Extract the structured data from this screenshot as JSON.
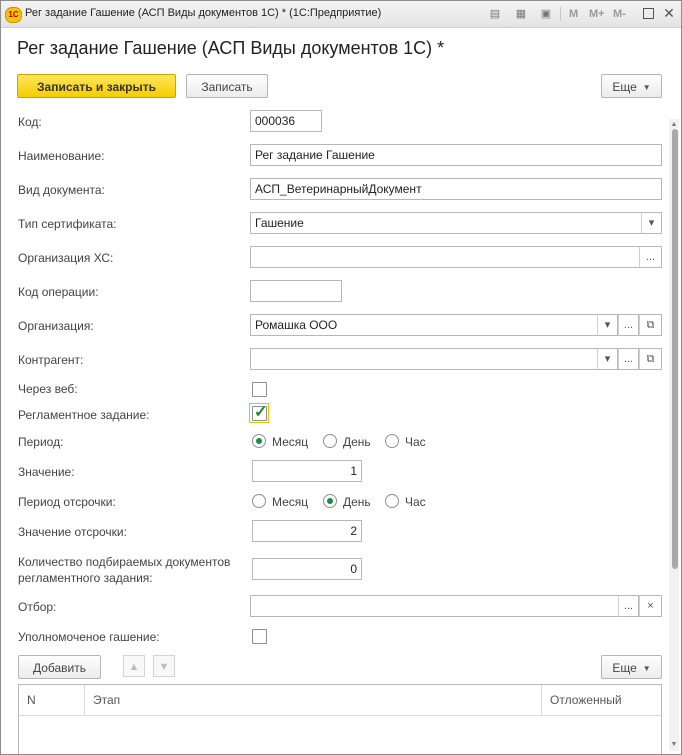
{
  "window": {
    "title": "Рег задание Гашение (АСП Виды документов 1С) * (1С:Предприятие)",
    "logo": "1С",
    "toolbar_icons": [
      "print-icon",
      "calculator-icon",
      "calendar-icon"
    ],
    "memory_buttons": [
      "M",
      "M+",
      "M-"
    ]
  },
  "form": {
    "title": "Рег задание Гашение (АСП Виды документов 1С) *",
    "save_close_label": "Записать и закрыть",
    "save_label": "Записать",
    "more_label": "Еще"
  },
  "fields": {
    "code": {
      "label": "Код:",
      "value": "000036"
    },
    "name": {
      "label": "Наименование:",
      "value": "Рег задание Гашение"
    },
    "doc_type": {
      "label": "Вид документа:",
      "value": "АСП_ВетеринарныйДокумент"
    },
    "cert_type": {
      "label": "Тип сертификата:",
      "value": "Гашение"
    },
    "org_hs": {
      "label": "Организация ХС:",
      "value": ""
    },
    "op_code": {
      "label": "Код операции:",
      "value": ""
    },
    "org": {
      "label": "Организация:",
      "value": "Ромашка ООО"
    },
    "counterparty": {
      "label": "Контрагент:",
      "value": ""
    },
    "via_web": {
      "label": "Через веб:",
      "checked": false
    },
    "scheduled": {
      "label": "Регламентное задание:",
      "checked": true
    },
    "period": {
      "label": "Период:",
      "options": [
        "Месяц",
        "День",
        "Час"
      ],
      "selected": "Месяц"
    },
    "value": {
      "label": "Значение:",
      "value": "1"
    },
    "delay_period": {
      "label": "Период отсрочки:",
      "options": [
        "Месяц",
        "День",
        "Час"
      ],
      "selected": "День"
    },
    "delay_value": {
      "label": "Значение отсрочки:",
      "value": "2"
    },
    "doc_count": {
      "label_line1": "Количество подбираемых документов",
      "label_line2": "регламентного задания:",
      "value": "0"
    },
    "filter": {
      "label": "Отбор:",
      "value": ""
    },
    "authorized": {
      "label": "Уполномоченое гашение:",
      "checked": false
    }
  },
  "table": {
    "add_label": "Добавить",
    "more_label": "Еще",
    "columns": [
      "N",
      "Этап",
      "Отложенный"
    ]
  }
}
